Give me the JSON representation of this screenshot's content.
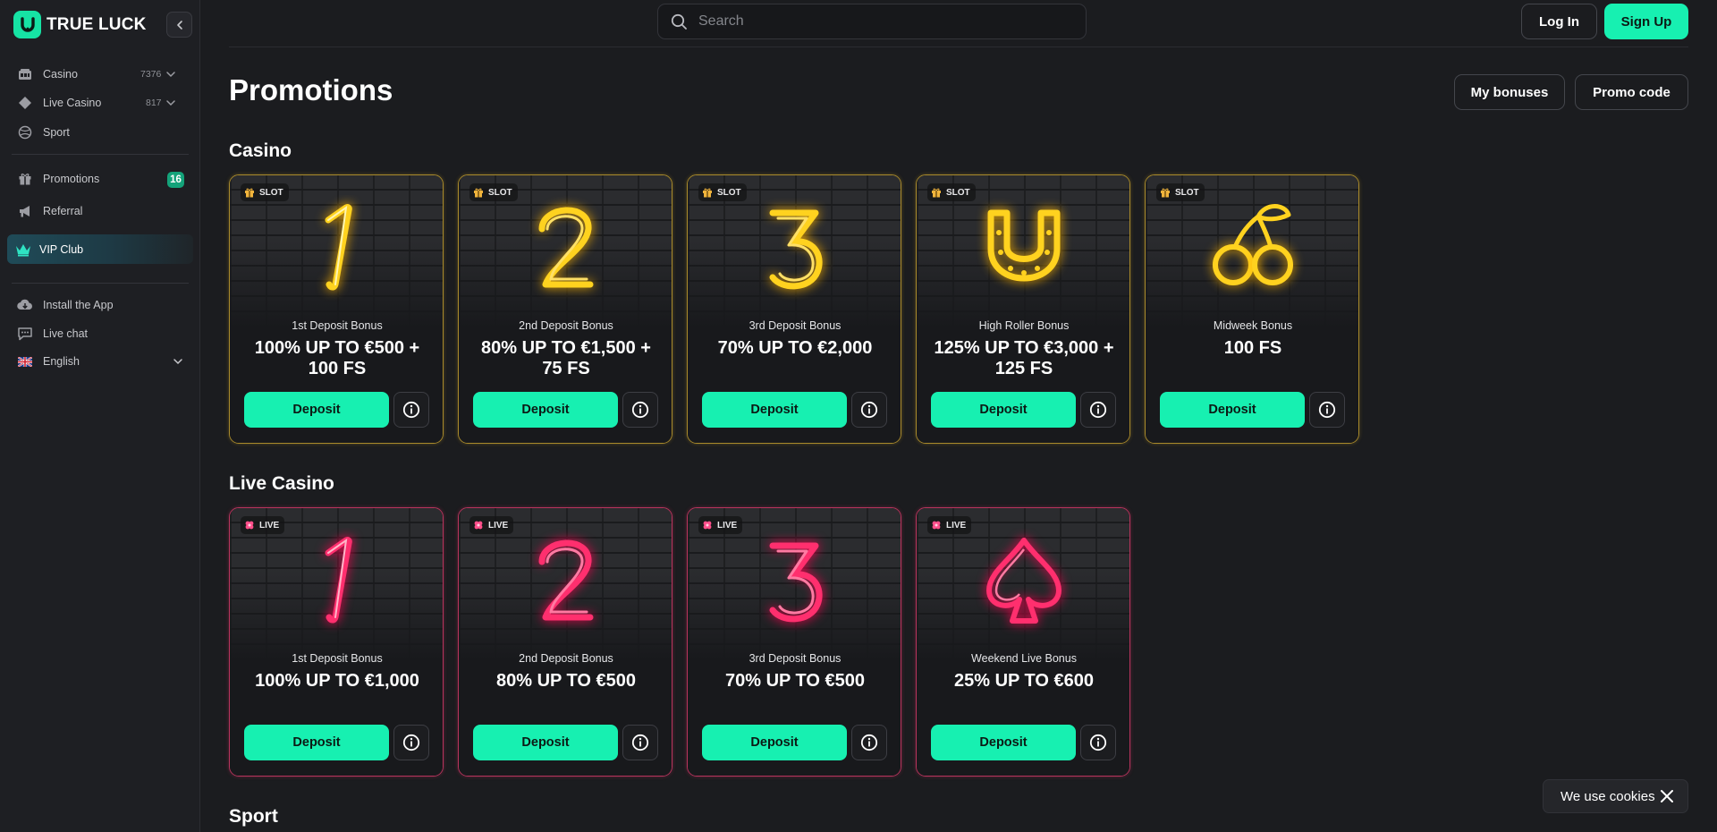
{
  "brand": {
    "name": "TRUE LUCK",
    "accent": "#16e3a4"
  },
  "sidebar": {
    "items": [
      {
        "label": "Casino",
        "count": "7376",
        "icon": "casino-icon"
      },
      {
        "label": "Live Casino",
        "count": "817",
        "icon": "live-casino-icon"
      },
      {
        "label": "Sport",
        "icon": "sport-icon"
      },
      {
        "label": "Promotions",
        "badge": "16",
        "icon": "gift-icon"
      },
      {
        "label": "Referral",
        "icon": "megaphone-icon"
      },
      {
        "label": "VIP Club",
        "icon": "crown-icon"
      },
      {
        "label": "Install the App",
        "icon": "cloud-download-icon"
      },
      {
        "label": "Live chat",
        "icon": "chat-icon"
      },
      {
        "label": "English",
        "icon": "uk-flag-icon"
      }
    ]
  },
  "header": {
    "search_placeholder": "Search",
    "login_label": "Log In",
    "signup_label": "Sign Up"
  },
  "page": {
    "title": "Promotions",
    "my_bonuses_label": "My bonuses",
    "promo_code_label": "Promo code"
  },
  "sections": [
    {
      "title": "Casino",
      "cards": [
        {
          "tag": "SLOT",
          "subtitle": "1st Deposit Bonus",
          "offer": "100% UP TO €500 + 100 FS",
          "button": "Deposit",
          "glyph": "neon-one"
        },
        {
          "tag": "SLOT",
          "subtitle": "2nd Deposit Bonus",
          "offer": "80% UP TO €1,500 + 75 FS",
          "button": "Deposit",
          "glyph": "neon-two"
        },
        {
          "tag": "SLOT",
          "subtitle": "3rd Deposit Bonus",
          "offer": "70% UP TO €2,000",
          "button": "Deposit",
          "glyph": "neon-three"
        },
        {
          "tag": "SLOT",
          "subtitle": "High Roller Bonus",
          "offer": "125% UP TO €3,000 + 125 FS",
          "button": "Deposit",
          "glyph": "neon-horseshoe"
        },
        {
          "tag": "SLOT",
          "subtitle": "Midweek Bonus",
          "offer": "100 FS",
          "button": "Deposit",
          "glyph": "neon-cherries"
        }
      ]
    },
    {
      "title": "Live Casino",
      "cards": [
        {
          "tag": "LIVE",
          "subtitle": "1st Deposit Bonus",
          "offer": "100% UP TO €1,000",
          "button": "Deposit",
          "glyph": "neon-one"
        },
        {
          "tag": "LIVE",
          "subtitle": "2nd Deposit Bonus",
          "offer": "80% UP TO €500",
          "button": "Deposit",
          "glyph": "neon-two"
        },
        {
          "tag": "LIVE",
          "subtitle": "3rd Deposit Bonus",
          "offer": "70% UP TO €500",
          "button": "Deposit",
          "glyph": "neon-three"
        },
        {
          "tag": "LIVE",
          "subtitle": "Weekend Live Bonus",
          "offer": "25% UP TO €600",
          "button": "Deposit",
          "glyph": "neon-spade"
        }
      ]
    },
    {
      "title": "Sport"
    }
  ],
  "cookie": {
    "text": "We use cookies"
  },
  "colors": {
    "gold_neon": "#ffd21f",
    "pink_neon": "#ff2f6e",
    "cta": "#17f0b1"
  }
}
